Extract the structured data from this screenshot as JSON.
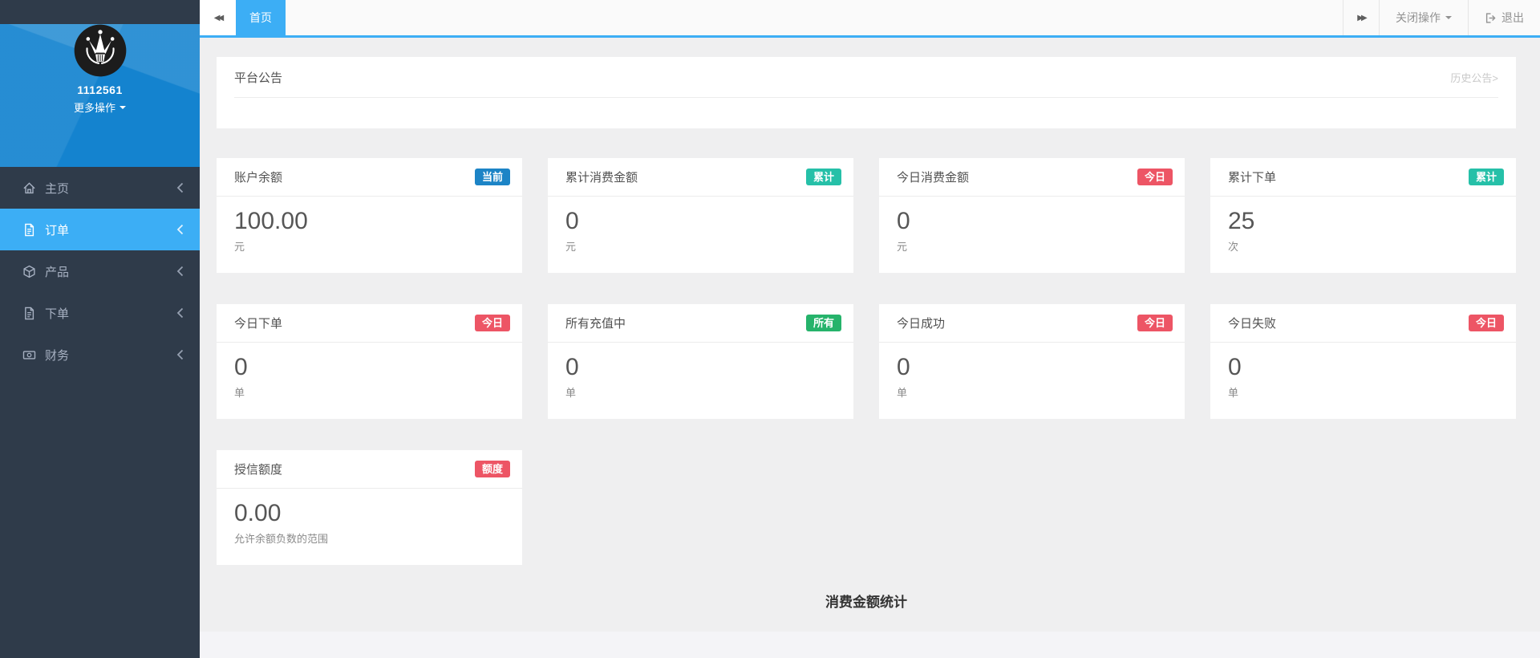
{
  "colors": {
    "accent_blue": "#3caef5",
    "header_blue": "#1483cf",
    "sidebar_dark": "#2f3b4a",
    "badge_blue": "#1c84c6",
    "badge_teal": "#26c0a8",
    "badge_red": "#ed5565",
    "badge_green": "#26b36b"
  },
  "sidebar": {
    "username": "1112561",
    "more_actions_label": "更多操作",
    "menu": [
      {
        "id": "home",
        "label": "主页",
        "icon": "home-icon",
        "active": false
      },
      {
        "id": "orders",
        "label": "订单",
        "icon": "file-icon",
        "active": true
      },
      {
        "id": "products",
        "label": "产品",
        "icon": "cube-icon",
        "active": false
      },
      {
        "id": "place-order",
        "label": "下单",
        "icon": "file-text-icon",
        "active": false
      },
      {
        "id": "finance",
        "label": "财务",
        "icon": "money-icon",
        "active": false
      }
    ]
  },
  "topbar": {
    "active_tab_label": "首页",
    "close_actions_label": "关闭操作",
    "logout_label": "退出"
  },
  "announcement": {
    "title": "平台公告",
    "history_link_label": "历史公告>"
  },
  "stat_cards": [
    {
      "id": "account-balance",
      "label": "账户余额",
      "badge": "当前",
      "badge_color": "#1c84c6",
      "value": "100.00",
      "unit": "元"
    },
    {
      "id": "total-consumption",
      "label": "累计消费金额",
      "badge": "累计",
      "badge_color": "#26c0a8",
      "value": "0",
      "unit": "元"
    },
    {
      "id": "today-consumption",
      "label": "今日消费金额",
      "badge": "今日",
      "badge_color": "#ed5565",
      "value": "0",
      "unit": "元"
    },
    {
      "id": "total-orders",
      "label": "累计下单",
      "badge": "累计",
      "badge_color": "#26c0a8",
      "value": "25",
      "unit": "次"
    },
    {
      "id": "today-orders",
      "label": "今日下单",
      "badge": "今日",
      "badge_color": "#ed5565",
      "value": "0",
      "unit": "单"
    },
    {
      "id": "all-recharging",
      "label": "所有充值中",
      "badge": "所有",
      "badge_color": "#26b36b",
      "value": "0",
      "unit": "单"
    },
    {
      "id": "today-success",
      "label": "今日成功",
      "badge": "今日",
      "badge_color": "#ed5565",
      "value": "0",
      "unit": "单"
    },
    {
      "id": "today-failed",
      "label": "今日失败",
      "badge": "今日",
      "badge_color": "#ed5565",
      "value": "0",
      "unit": "单"
    },
    {
      "id": "credit-limit",
      "label": "授信额度",
      "badge": "额度",
      "badge_color": "#ed5565",
      "value": "0.00",
      "unit": "允许余额负数的范围"
    }
  ],
  "chart_section": {
    "title": "消费金额统计"
  }
}
